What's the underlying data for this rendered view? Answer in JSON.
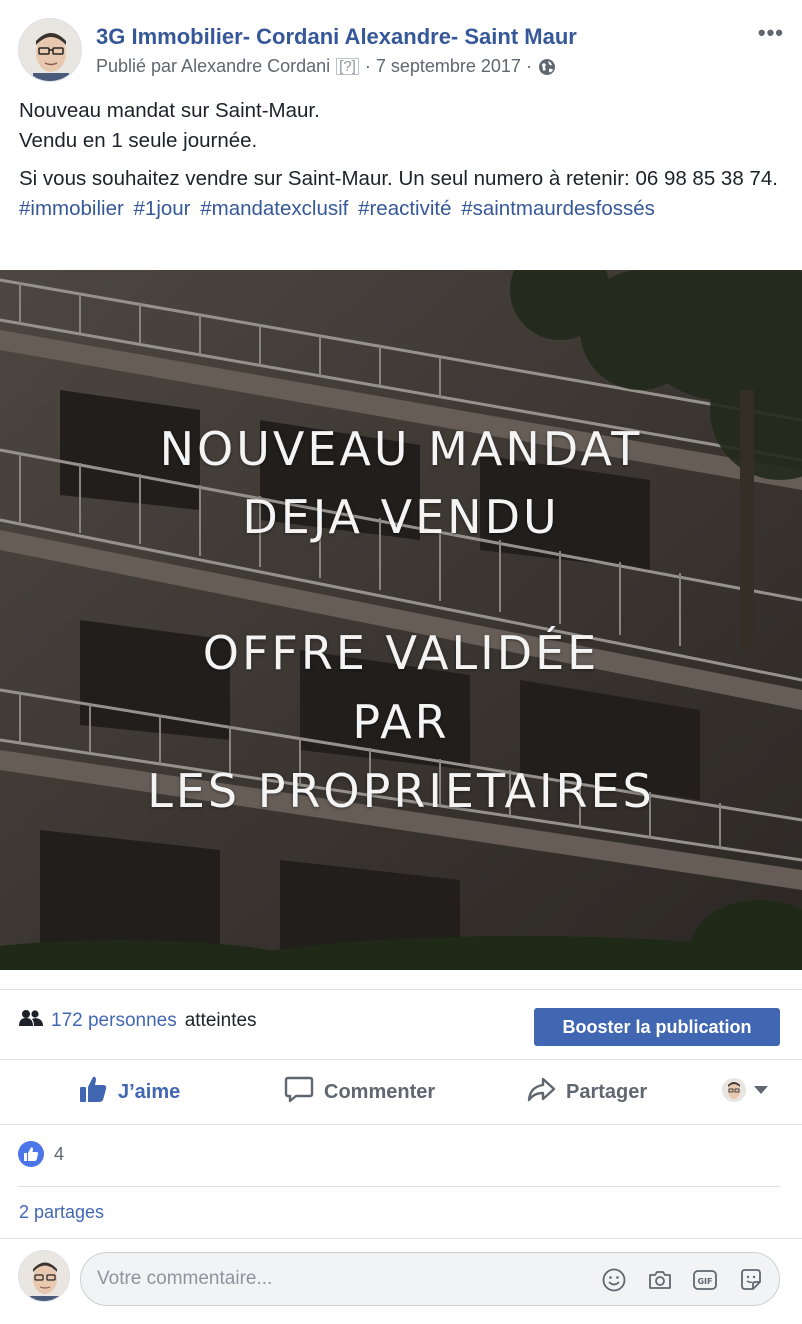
{
  "post": {
    "page_name": "3G Immobilier- Cordani Alexandre- Saint Maur",
    "published_by": "Publié par Alexandre Cordani",
    "help_marker": "[?]",
    "date": "· 7 septembre 2017 ·",
    "more": "•••",
    "text_lines": [
      "Nouveau mandat sur Saint-Maur.",
      "Vendu en 1 seule journée.",
      "Si vous souhaitez vendre sur Saint-Maur. Un seul numero à retenir: 06 98 85 38 74."
    ],
    "hashtags": [
      "#immobilier",
      "#1jour",
      "#mandatexclusif",
      "#reactivité",
      "#saintmaurdesfossés"
    ]
  },
  "image_overlay": {
    "line1": "NOUVEAU MANDAT",
    "line2": "DEJA VENDU",
    "line3": "OFFRE VALIDÉE",
    "line4": "PAR",
    "line5": "LES PROPRIETAIRES"
  },
  "reach": {
    "count": "172 personnes",
    "suffix": "atteintes",
    "boost_label": "Booster la publication"
  },
  "actions": {
    "like": "J’aime",
    "comment": "Commenter",
    "share": "Partager"
  },
  "reactions": {
    "count": "4",
    "shares": "2 partages"
  },
  "comment": {
    "placeholder": "Votre commentaire..."
  },
  "colors": {
    "link": "#365899",
    "accent": "#4267b2",
    "like_badge": "#4a76e8"
  }
}
